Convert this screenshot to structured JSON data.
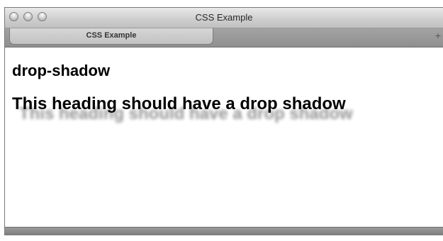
{
  "window": {
    "title": "CSS Example"
  },
  "tabs": [
    {
      "label": "CSS Example"
    }
  ],
  "tabstrip": {
    "new_tab_glyph": "+"
  },
  "content": {
    "heading": "drop-shadow",
    "shadow_heading": "This heading should have a drop shadow"
  },
  "icons": {
    "close": "window-close-icon",
    "minimize": "window-minimize-icon",
    "zoom": "window-zoom-icon",
    "new_tab": "new-tab-icon"
  }
}
